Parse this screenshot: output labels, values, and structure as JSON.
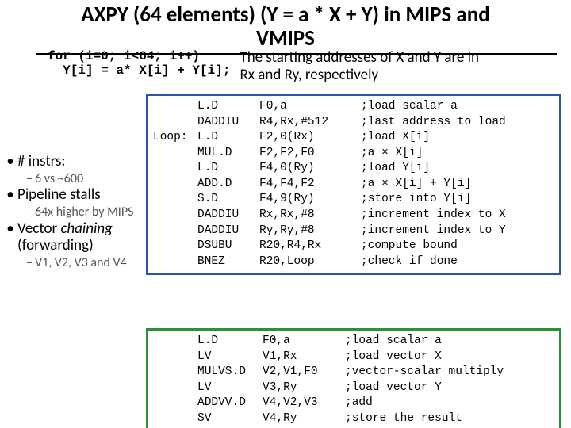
{
  "title_line1": "AXPY (64 elements) (Y = a * X + Y) in MIPS and",
  "title_line2": "VMIPS",
  "src_code": "for (i=0; i<64; i++)\n  Y[i] = a* X[i] + Y[i];",
  "addr_note_l1": "The starting addresses of X and Y are in",
  "addr_note_l2": "Rx and Ry, respectively",
  "bul1": "# instrs:",
  "bul1s": "6 vs ~600",
  "bul2": "Pipeline stalls",
  "bul2s": "64x higher by MIPS",
  "bul3a": "Vector ",
  "bul3b": "chaining",
  "bul3c": "(forwarding)",
  "bul3s": "V1, V2, V3 and V4",
  "mips": [
    {
      "lbl": "",
      "op": "L.D",
      "args": "F0,a",
      "c": ";load scalar a"
    },
    {
      "lbl": "",
      "op": "DADDIU",
      "args": "R4,Rx,#512",
      "c": ";last address to load"
    },
    {
      "lbl": "Loop:",
      "op": "L.D",
      "args": "F2,0(Rx)",
      "c": ";load X[i]"
    },
    {
      "lbl": "",
      "op": "MUL.D",
      "args": "F2,F2,F0",
      "c": ";a × X[i]"
    },
    {
      "lbl": "",
      "op": "L.D",
      "args": "F4,0(Ry)",
      "c": ";load Y[i]"
    },
    {
      "lbl": "",
      "op": "ADD.D",
      "args": "F4,F4,F2",
      "c": ";a × X[i] + Y[i]"
    },
    {
      "lbl": "",
      "op": "S.D",
      "args": "F4,9(Ry)",
      "c": ";store into Y[i]"
    },
    {
      "lbl": "",
      "op": "DADDIU",
      "args": "Rx,Rx,#8",
      "c": ";increment index to X"
    },
    {
      "lbl": "",
      "op": "DADDIU",
      "args": "Ry,Ry,#8",
      "c": ";increment index to Y"
    },
    {
      "lbl": "",
      "op": "DSUBU",
      "args": "R20,R4,Rx",
      "c": ";compute bound"
    },
    {
      "lbl": "",
      "op": "BNEZ",
      "args": "R20,Loop",
      "c": ";check if done"
    }
  ],
  "vmips": [
    {
      "lbl": "",
      "op": "L.D",
      "args": "F0,a",
      "c": ";load scalar a"
    },
    {
      "lbl": "",
      "op": "LV",
      "args": "V1,Rx",
      "c": ";load vector X"
    },
    {
      "lbl": "",
      "op": "MULVS.D",
      "args": "V2,V1,F0",
      "c": ";vector-scalar multiply"
    },
    {
      "lbl": "",
      "op": "LV",
      "args": "V3,Ry",
      "c": ";load vector Y"
    },
    {
      "lbl": "",
      "op": "ADDVV.D",
      "args": "V4,V2,V3",
      "c": ";add"
    },
    {
      "lbl": "",
      "op": "SV",
      "args": "V4,Ry",
      "c": ";store the result"
    }
  ]
}
